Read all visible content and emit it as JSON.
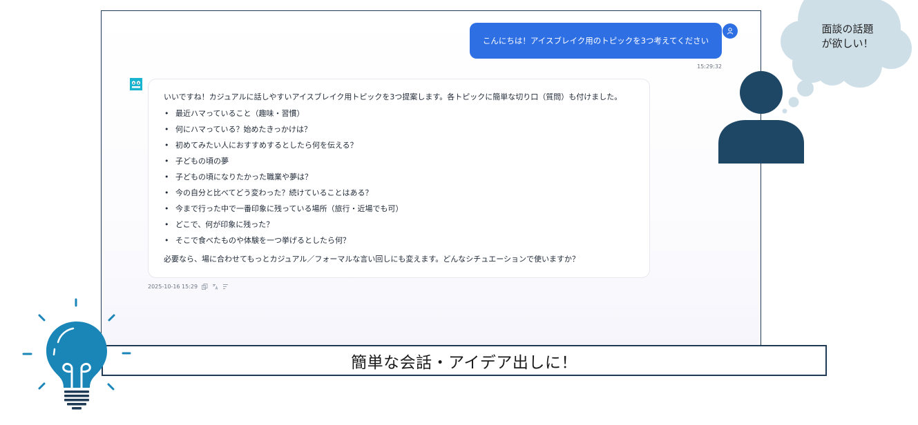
{
  "user_message": {
    "text": "こんにちは！アイスブレイク用のトピックを3つ考えてください",
    "time": "15:29:32"
  },
  "bot_message": {
    "intro": "いいですね！カジュアルに話しやすいアイスブレイク用トピックを3つ提案します。各トピックに簡単な切り口（質問）も付けました。",
    "items": [
      "最近ハマっていること（趣味・習慣）",
      "何にハマっている？始めたきっかけは？",
      "初めてみたい人におすすめするとしたら何を伝える？",
      "子どもの頃の夢",
      "子どもの頃になりたかった職業や夢は？",
      "今の自分と比べてどう変わった？続けていることはある？",
      "今まで行った中で一番印象に残っている場所（旅行・近場でも可）",
      "どこで、何が印象に残った？",
      "そこで食べたものや体験を一つ挙げるとしたら何？"
    ],
    "outro": "必要なら、場に合わせてもっとカジュアル／フォーマルな言い回しにも変えます。どんなシチュエーションで使いますか？",
    "timestamp": "2025-10-16 15:29"
  },
  "thought": {
    "line1": "面談の話題",
    "line2": "が欲しい！"
  },
  "caption": "簡単な会話・アイデア出しに！",
  "colors": {
    "user_bubble": "#2f6fe4",
    "figure": "#1e4766",
    "cloud": "#cfdfe8",
    "bulb": "#1a86b8",
    "border": "#1e3a55"
  },
  "icons": {
    "user_avatar": "user-icon",
    "bot_avatar": "bot-icon",
    "copy": "copy-icon",
    "translate": "translate-icon",
    "text_format": "text-format-icon",
    "bulb": "lightbulb-icon"
  }
}
